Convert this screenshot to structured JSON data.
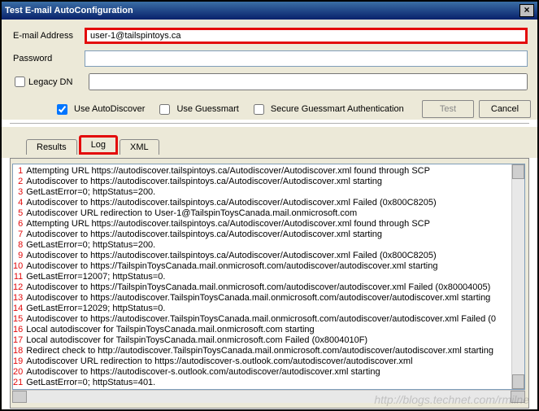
{
  "window": {
    "title": "Test E-mail AutoConfiguration"
  },
  "form": {
    "email_label": "E-mail Address",
    "email_value": "user-1@tailspintoys.ca",
    "password_label": "Password",
    "password_value": "",
    "legacy_dn_label": "Legacy DN",
    "legacy_dn_value": ""
  },
  "options": {
    "autodiscover_label": "Use AutoDiscover",
    "guessmart_label": "Use Guessmart",
    "secure_guessmart_label": "Secure Guessmart Authentication",
    "test_label": "Test",
    "cancel_label": "Cancel"
  },
  "tabs": {
    "results": "Results",
    "log": "Log",
    "xml": "XML"
  },
  "log_lines": [
    "Attempting URL https://autodiscover.tailspintoys.ca/Autodiscover/Autodiscover.xml found through SCP",
    "Autodiscover to https://autodiscover.tailspintoys.ca/Autodiscover/Autodiscover.xml starting",
    "GetLastError=0; httpStatus=200.",
    "Autodiscover to https://autodiscover.tailspintoys.ca/Autodiscover/Autodiscover.xml Failed (0x800C8205)",
    "Autodiscover URL redirection to User-1@TailspinToysCanada.mail.onmicrosoft.com",
    "Attempting URL https://autodiscover.tailspintoys.ca/Autodiscover/Autodiscover.xml found through SCP",
    "Autodiscover to https://autodiscover.tailspintoys.ca/Autodiscover/Autodiscover.xml starting",
    "GetLastError=0; httpStatus=200.",
    "Autodiscover to https://autodiscover.tailspintoys.ca/Autodiscover/Autodiscover.xml Failed (0x800C8205)",
    "Autodiscover to https://TailspinToysCanada.mail.onmicrosoft.com/autodiscover/autodiscover.xml starting",
    "GetLastError=12007; httpStatus=0.",
    "Autodiscover to https://TailspinToysCanada.mail.onmicrosoft.com/autodiscover/autodiscover.xml Failed (0x80004005)",
    "Autodiscover to https://autodiscover.TailspinToysCanada.mail.onmicrosoft.com/autodiscover/autodiscover.xml starting",
    "GetLastError=12029; httpStatus=0.",
    "Autodiscover to https://autodiscover.TailspinToysCanada.mail.onmicrosoft.com/autodiscover/autodiscover.xml Failed (0",
    "Local autodiscover for TailspinToysCanada.mail.onmicrosoft.com starting",
    "Local autodiscover for TailspinToysCanada.mail.onmicrosoft.com Failed (0x8004010F)",
    "Redirect check to http://autodiscover.TailspinToysCanada.mail.onmicrosoft.com/autodiscover/autodiscover.xml starting",
    "Autodiscover URL redirection to https://autodiscover-s.outlook.com/autodiscover/autodiscover.xml",
    "Autodiscover to https://autodiscover-s.outlook.com/autodiscover/autodiscover.xml starting",
    "GetLastError=0; httpStatus=401."
  ],
  "watermark": "http://blogs.technet.com/rmilne"
}
